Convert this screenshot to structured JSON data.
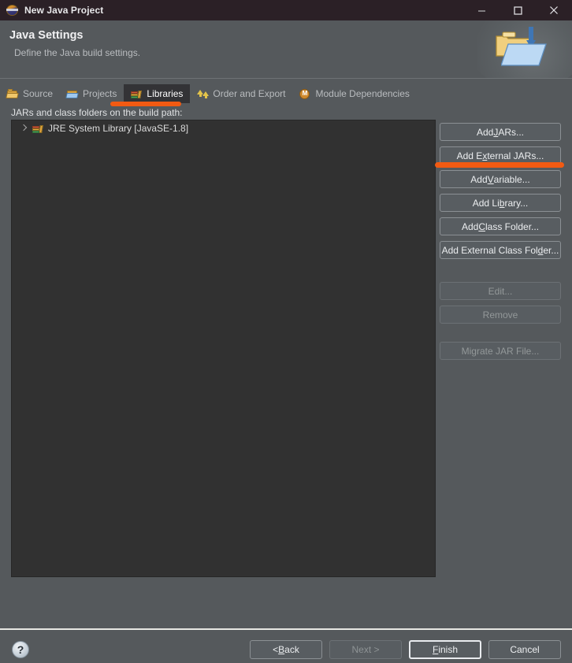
{
  "window": {
    "title": "New Java Project",
    "icon": "java-project-icon",
    "controls": {
      "minimize": "minimize-icon",
      "maximize": "maximize-icon",
      "close": "close-icon"
    }
  },
  "banner": {
    "title": "Java Settings",
    "subtitle": "Define the Java build settings.",
    "art_icon": "java-build-path-banner-icon"
  },
  "tabs": [
    {
      "label": "Source",
      "icon": "source-folder-icon",
      "active": false
    },
    {
      "label": "Projects",
      "icon": "projects-folder-icon",
      "active": false
    },
    {
      "label": "Libraries",
      "icon": "libraries-books-icon",
      "active": true
    },
    {
      "label": "Order and Export",
      "icon": "order-export-arrows-icon",
      "active": false
    },
    {
      "label": "Module Dependencies",
      "icon": "module-m-circle-icon",
      "active": false
    }
  ],
  "section": {
    "label": "JARs and class folders on the build path:"
  },
  "tree": {
    "items": [
      {
        "label": "JRE System Library [JavaSE-1.8]",
        "icon": "libraries-books-icon",
        "expandable": true
      }
    ]
  },
  "buttons": {
    "add_jars": {
      "pre": "Add ",
      "mn": "J",
      "post": "ARs...",
      "enabled": true
    },
    "add_external_jars": {
      "pre": "Add E",
      "mn": "x",
      "post": "ternal JARs...",
      "enabled": true
    },
    "add_variable": {
      "pre": "Add ",
      "mn": "V",
      "post": "ariable...",
      "enabled": true
    },
    "add_library": {
      "pre": "Add Li",
      "mn": "b",
      "post": "rary...",
      "enabled": true
    },
    "add_class_folder": {
      "pre": "Add ",
      "mn": "C",
      "post": "lass Folder...",
      "enabled": true
    },
    "add_external_class_folder": {
      "pre": "Add External Class Fol",
      "mn": "d",
      "post": "er...",
      "enabled": true
    },
    "edit": {
      "pre": "Edit...",
      "mn": "",
      "post": "",
      "enabled": false
    },
    "remove": {
      "pre": "Remove",
      "mn": "",
      "post": "",
      "enabled": false
    },
    "migrate_jar_file": {
      "pre": "Migrate JAR File...",
      "mn": "",
      "post": "",
      "enabled": false
    }
  },
  "footer": {
    "help": "?",
    "back": {
      "pre": "< ",
      "mn": "B",
      "post": "ack",
      "enabled": true,
      "default": false
    },
    "next": {
      "pre": "Next >",
      "mn": "",
      "post": "",
      "enabled": false,
      "default": false
    },
    "finish": {
      "pre": "",
      "mn": "F",
      "post": "inish",
      "enabled": true,
      "default": true
    },
    "cancel": {
      "pre": "Cancel",
      "mn": "",
      "post": "",
      "enabled": true,
      "default": false
    }
  },
  "annotations": {
    "highlight_color": "#f25a12",
    "marks": [
      {
        "target": "tab-libraries",
        "shape": "underline-bar"
      },
      {
        "target": "add-external-jars-button",
        "shape": "underline-bar"
      }
    ]
  },
  "colors": {
    "titlebar_bg": "#2b2026",
    "dialog_bg": "#55595c",
    "list_bg": "#313131",
    "active_tab_bg": "#333336",
    "text_primary": "#eceef0",
    "text_muted": "#b9bcbf",
    "accent": "#f25a12"
  }
}
